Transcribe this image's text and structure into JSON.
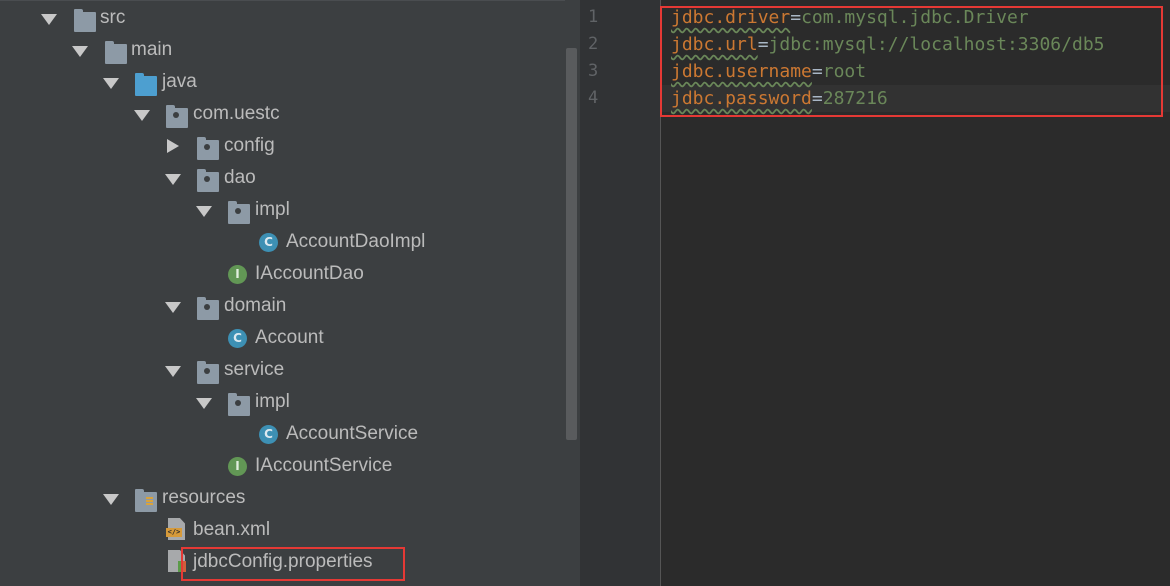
{
  "project_tree": {
    "items": [
      {
        "label": "src",
        "expanded": true,
        "icon": "folder-icon"
      },
      {
        "label": "main",
        "expanded": true,
        "icon": "folder-icon"
      },
      {
        "label": "java",
        "expanded": true,
        "icon": "source-folder-icon"
      },
      {
        "label": "com.uestc",
        "expanded": true,
        "icon": "package-icon"
      },
      {
        "label": "config",
        "expanded": false,
        "icon": "package-icon"
      },
      {
        "label": "dao",
        "expanded": true,
        "icon": "package-icon"
      },
      {
        "label": "impl",
        "expanded": true,
        "icon": "package-icon"
      },
      {
        "label": "AccountDaoImpl",
        "icon": "class-icon",
        "badge": "C"
      },
      {
        "label": "IAccountDao",
        "icon": "interface-icon",
        "badge": "I"
      },
      {
        "label": "domain",
        "expanded": true,
        "icon": "package-icon"
      },
      {
        "label": "Account",
        "icon": "class-icon",
        "badge": "C"
      },
      {
        "label": "service",
        "expanded": true,
        "icon": "package-icon"
      },
      {
        "label": "impl",
        "expanded": true,
        "icon": "package-icon"
      },
      {
        "label": "AccountService",
        "icon": "class-icon",
        "badge": "C"
      },
      {
        "label": "IAccountService",
        "icon": "interface-icon",
        "badge": "I"
      },
      {
        "label": "resources",
        "expanded": true,
        "icon": "resources-folder-icon"
      },
      {
        "label": "bean.xml",
        "icon": "xml-file-icon"
      },
      {
        "label": "jdbcConfig.properties",
        "icon": "properties-file-icon",
        "highlighted": true
      }
    ]
  },
  "editor": {
    "line_numbers": [
      "1",
      "2",
      "3",
      "4"
    ],
    "lines": [
      {
        "key": "jdbc.driver",
        "sep": "=",
        "value": "com.mysql.jdbc.Driver"
      },
      {
        "key": "jdbc.url",
        "sep": "=",
        "value": "jdbc:mysql://localhost:3306/db5"
      },
      {
        "key": "jdbc.username",
        "sep": "=",
        "value": "root"
      },
      {
        "key": "jdbc.password",
        "sep": "=",
        "value": "287216"
      }
    ],
    "highlighted": true
  },
  "colors": {
    "tree_background": "#3c3f41",
    "editor_background": "#2b2b2b",
    "property_key": "#cc7832",
    "property_value": "#6a8759",
    "highlight_box": "#e53935"
  }
}
